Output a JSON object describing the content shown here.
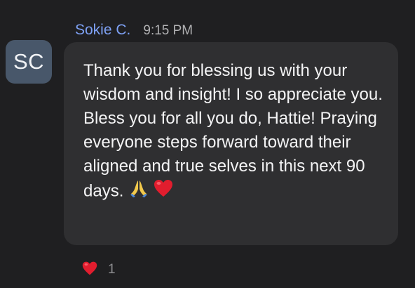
{
  "message": {
    "avatar_initials": "SC",
    "sender_name": "Sokie C.",
    "timestamp": "9:15 PM",
    "text": "Thank you for blessing us with your wisdom and insight! I so appreciate you. Bless you for all you do, Hattie! Praying everyone steps forward toward their aligned and true selves in this next 90 days.",
    "emojis": [
      "praying-hands-icon",
      "red-heart-icon"
    ]
  },
  "reaction": {
    "icon": "red-heart-icon",
    "count": "1"
  },
  "colors": {
    "background": "#1f1f21",
    "bubble": "#2f2f31",
    "avatar": "#48576a",
    "sender_name": "#7ea1f5",
    "timestamp": "#b1b1b3",
    "message_text": "#f4f4f5",
    "heart": "#e11d2e"
  }
}
